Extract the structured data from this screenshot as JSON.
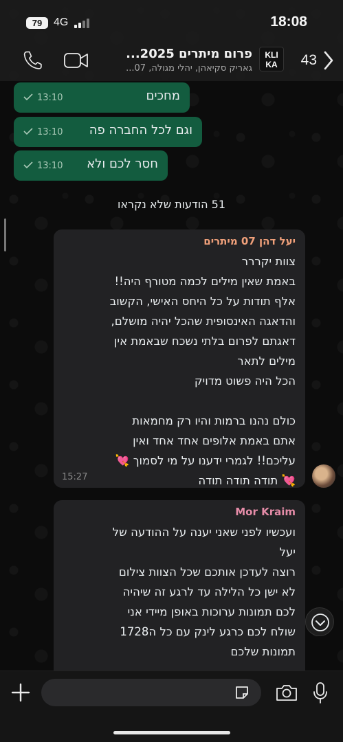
{
  "status_bar": {
    "time": "18:08",
    "battery": "79",
    "network": "4G"
  },
  "header": {
    "unread_count": "43",
    "group_name": "פרום מיתרים 2025...",
    "participants": "גאריק סקיאהן, יהלי מגולה, 07...",
    "logo_text_top": "KLI",
    "logo_text_bottom": "KA"
  },
  "messages": {
    "outgoing": [
      {
        "text": "מחכים",
        "time": "13:10"
      },
      {
        "text": "וגם לכל החברה פה",
        "time": "13:10"
      },
      {
        "text": "חסר לכם ולא",
        "time": "13:10"
      }
    ],
    "unread_banner": "51 הודעות שלא נקראו",
    "incoming": [
      {
        "sender": "יעל דהן 07 מיתרים",
        "sender_color": "#f0a07a",
        "text": "צוות יקררר\nבאמת שאין מילים לכמה מטורף היה!!\nאלף תודות על כל היחס האישי, הקשוב\nוהדאגה האינסופית שהכל יהיה מושלם,\nדאגתם לפרום בלתי נשכח שבאמת אין\nמילים לתאר\nהכל היה פשוט מדויק\n\nכולם נהנו ברמות והיו רק מחמאות\nאתם באמת אלופים אחד אחד ואין\nעליכם!! לגמרי ידענו על מי לסמוך 💘\n💘 תודה תודה תודה",
        "time": "15:27"
      },
      {
        "sender": "Mor Kraim",
        "sender_color": "#e58ca8",
        "text": "ועכשיו לפני שאני יענה על ההודעה של\nיעל\nרוצה לעדכן אותכם שכל הצוות צילום\nלא ישן כל הלילה עד לרגע זה שיהיה\nלכם תמונות ערוכות באופן מיידי אני\nשולח לכם כרגע לינק עם כל ה1728\nתמונות שלכם",
        "time": ""
      }
    ]
  },
  "composer": {
    "input_value": "",
    "input_placeholder": ""
  },
  "colors": {
    "outgoing_bubble": "#135c3f",
    "incoming_bubble": "#222224",
    "background": "#0c0c0c"
  },
  "icons": [
    "phone-icon",
    "video-icon",
    "chevron-left-icon",
    "check-icon",
    "chevron-down-icon",
    "plus-icon",
    "sticker-icon",
    "camera-icon",
    "mic-icon"
  ]
}
